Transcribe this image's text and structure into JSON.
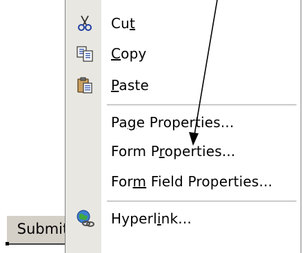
{
  "form": {
    "submit_label": "Submit"
  },
  "menu": {
    "items": [
      {
        "icon": "scissors-icon",
        "pre": "Cu",
        "key": "t",
        "post": ""
      },
      {
        "icon": "copy-icon",
        "pre": "",
        "key": "C",
        "post": "opy"
      },
      {
        "icon": "paste-icon",
        "pre": "",
        "key": "P",
        "post": "aste"
      },
      {
        "icon": "",
        "pre": "Pa",
        "key": "g",
        "post": "e Properties..."
      },
      {
        "icon": "",
        "pre": "Form P",
        "key": "r",
        "post": "operties..."
      },
      {
        "icon": "",
        "pre": "For",
        "key": "m",
        "post": " Field Properties..."
      },
      {
        "icon": "hyperlink-globe-icon",
        "pre": "Hyperl",
        "key": "i",
        "post": "nk..."
      }
    ]
  },
  "colors": {
    "menu_gutter": "#e8e7e2",
    "arrow": "#000000"
  }
}
